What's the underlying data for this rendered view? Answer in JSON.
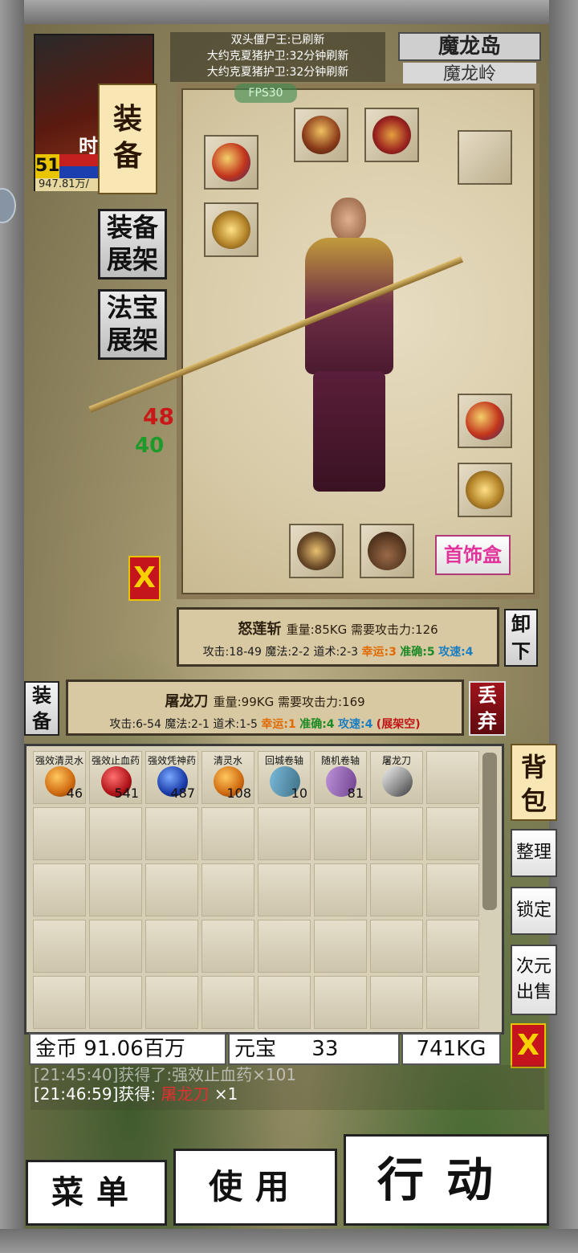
{
  "player": {
    "name_fragment": "时",
    "level": "51",
    "hp": "84",
    "mp": "14",
    "exp": "947.81万/"
  },
  "tabs": {
    "equip_vertical": "装备",
    "equip_shelf": "装备展架",
    "treasure_shelf": "法宝展架"
  },
  "notice": {
    "line1": "双头僵尸王:已刷新",
    "line2": "大约克夏猪护卫:32分钟刷新",
    "line3": "大约克夏猪护卫:32分钟刷新"
  },
  "map": {
    "region": "魔龙岛",
    "area": "魔龙岭"
  },
  "fps": "FPS30",
  "equip_panel": {
    "jewelry_box": "首饰盒"
  },
  "selected_item": {
    "name": "怒莲斩",
    "header": "重量:85KG 需要攻击力:126",
    "base": "攻击:18-49 魔法:2-2 道术:2-3 ",
    "luck": "幸运:3",
    "accuracy": "准确:5",
    "speed": "攻速:4",
    "unequip_label": "卸下"
  },
  "compare_item": {
    "name": "屠龙刀",
    "header": "重量:99KG 需要攻击力:169",
    "base": "攻击:6-54 魔法:2-1 道术:1-5 ",
    "luck": "幸运:1",
    "accuracy": "准确:4",
    "speed": "攻速:4",
    "shelf": "(展架空)",
    "equip_label": "装备",
    "discard_label": "丢弃"
  },
  "battle": {
    "damage_red": "48",
    "damage_green": "40",
    "close_x": "X"
  },
  "bag": {
    "label": "背包",
    "sort": "整理",
    "lock": "锁定",
    "sell": "次元出售",
    "close_x": "X",
    "items": [
      {
        "name": "强效清灵水",
        "count": "46",
        "icon": "orange-potion-icon"
      },
      {
        "name": "强效止血药",
        "count": "541",
        "icon": "red-potion-icon"
      },
      {
        "name": "强效凭神药",
        "count": "487",
        "icon": "blue-potion-icon"
      },
      {
        "name": "清灵水",
        "count": "108",
        "icon": "orange-potion-icon"
      },
      {
        "name": "回城卷轴",
        "count": "10",
        "icon": "scroll-icon"
      },
      {
        "name": "随机卷轴",
        "count": "81",
        "icon": "scroll-icon"
      },
      {
        "name": "屠龙刀",
        "count": "",
        "icon": "blade-icon"
      }
    ]
  },
  "currency": {
    "gold_label": "金币",
    "gold_value": "91.06百万",
    "ingot_label": "元宝",
    "ingot_value": "33",
    "weight": "741KG"
  },
  "log": {
    "line1_faded": "[21:45:40]获得了:强效止血药×101",
    "line2_prefix": "[21:46:59]获得: ",
    "line2_item": "屠龙刀",
    "line2_suffix": " ×1"
  },
  "bottom": {
    "menu": "菜单",
    "use": "使用",
    "action": "行动"
  },
  "colors": {
    "luck": "#e06a00",
    "accuracy": "#1d8a25",
    "speed": "#1b7ec0",
    "warn_red": "#c01818"
  }
}
